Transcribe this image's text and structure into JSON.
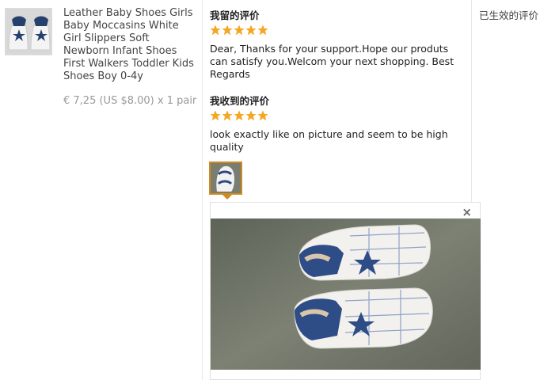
{
  "product": {
    "title": "Leather Baby Shoes Girls Baby Moccasins White Girl Slippers Soft Newborn Infant Shoes First Walkers Toddler Kids Shoes Boy 0-4y",
    "price": "€ 7,25 (US $8.00) x 1 pair"
  },
  "seller_feedback": {
    "heading": "我留的评价",
    "rating": 5,
    "text": "Dear, Thanks for your support.Hope our produts can satisfy you.Welcom your next shopping. Best Regards"
  },
  "buyer_feedback": {
    "heading": "我收到的评价",
    "rating": 5,
    "text": "look exactly like on picture and seem to be high quality"
  },
  "preview": {
    "close_label": "×"
  },
  "status": {
    "label": "已生效的评价"
  },
  "colors": {
    "star": "#f5a623",
    "thumb_border": "#d08a1f"
  }
}
